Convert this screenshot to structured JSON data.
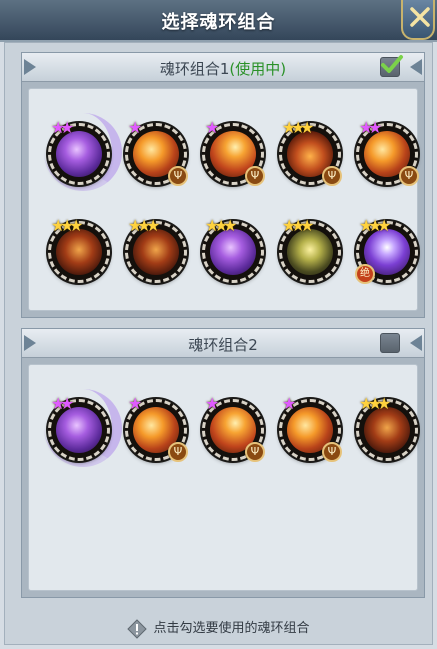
{
  "window": {
    "title": "选择魂环组合"
  },
  "combo1": {
    "title": "魂环组合1",
    "status": "(使用中)",
    "checked": true,
    "rings": [
      {
        "art": "purple",
        "stars": 2,
        "star_color": "purple",
        "glow": true,
        "badge": null
      },
      {
        "art": "fire",
        "stars": 1,
        "star_color": "purple",
        "glow": false,
        "badge": "trident-icon"
      },
      {
        "art": "fire2",
        "stars": 1,
        "star_color": "purple",
        "glow": false,
        "badge": "trident-icon"
      },
      {
        "art": "ember",
        "stars": 3,
        "star_color": "gold",
        "glow": false,
        "badge": "trident-icon"
      },
      {
        "art": "fire",
        "stars": 2,
        "star_color": "purple",
        "glow": false,
        "badge": "trident-icon"
      },
      {
        "art": "beast",
        "stars": 3,
        "star_color": "gold",
        "glow": false,
        "badge": null
      },
      {
        "art": "beast",
        "stars": 3,
        "star_color": "gold",
        "glow": false,
        "badge": null
      },
      {
        "art": "purple",
        "stars": 3,
        "star_color": "gold",
        "glow": false,
        "badge": null
      },
      {
        "art": "golem",
        "stars": 3,
        "star_color": "gold",
        "glow": false,
        "badge": null
      },
      {
        "art": "storm",
        "stars": 3,
        "star_color": "gold",
        "glow": false,
        "badge": "绝"
      }
    ]
  },
  "combo2": {
    "title": "魂环组合2",
    "checked": false,
    "rings": [
      {
        "art": "purple",
        "stars": 2,
        "star_color": "purple",
        "glow": true,
        "badge": null
      },
      {
        "art": "fire",
        "stars": 1,
        "star_color": "purple",
        "glow": false,
        "badge": "trident-icon"
      },
      {
        "art": "fire2",
        "stars": 1,
        "star_color": "purple",
        "glow": false,
        "badge": "trident-icon"
      },
      {
        "art": "fire",
        "stars": 1,
        "star_color": "purple",
        "glow": false,
        "badge": "trident-icon"
      },
      {
        "art": "beast",
        "stars": 3,
        "star_color": "gold",
        "glow": false,
        "badge": null
      }
    ]
  },
  "footer": {
    "hint": "点击勾选要使用的魂环组合",
    "icon": "warning-diamond-icon"
  },
  "colors": {
    "active_status": "#2a9128",
    "title_bar": "#34465a",
    "star_purple": "#e05bff",
    "star_gold": "#ffd23e"
  }
}
